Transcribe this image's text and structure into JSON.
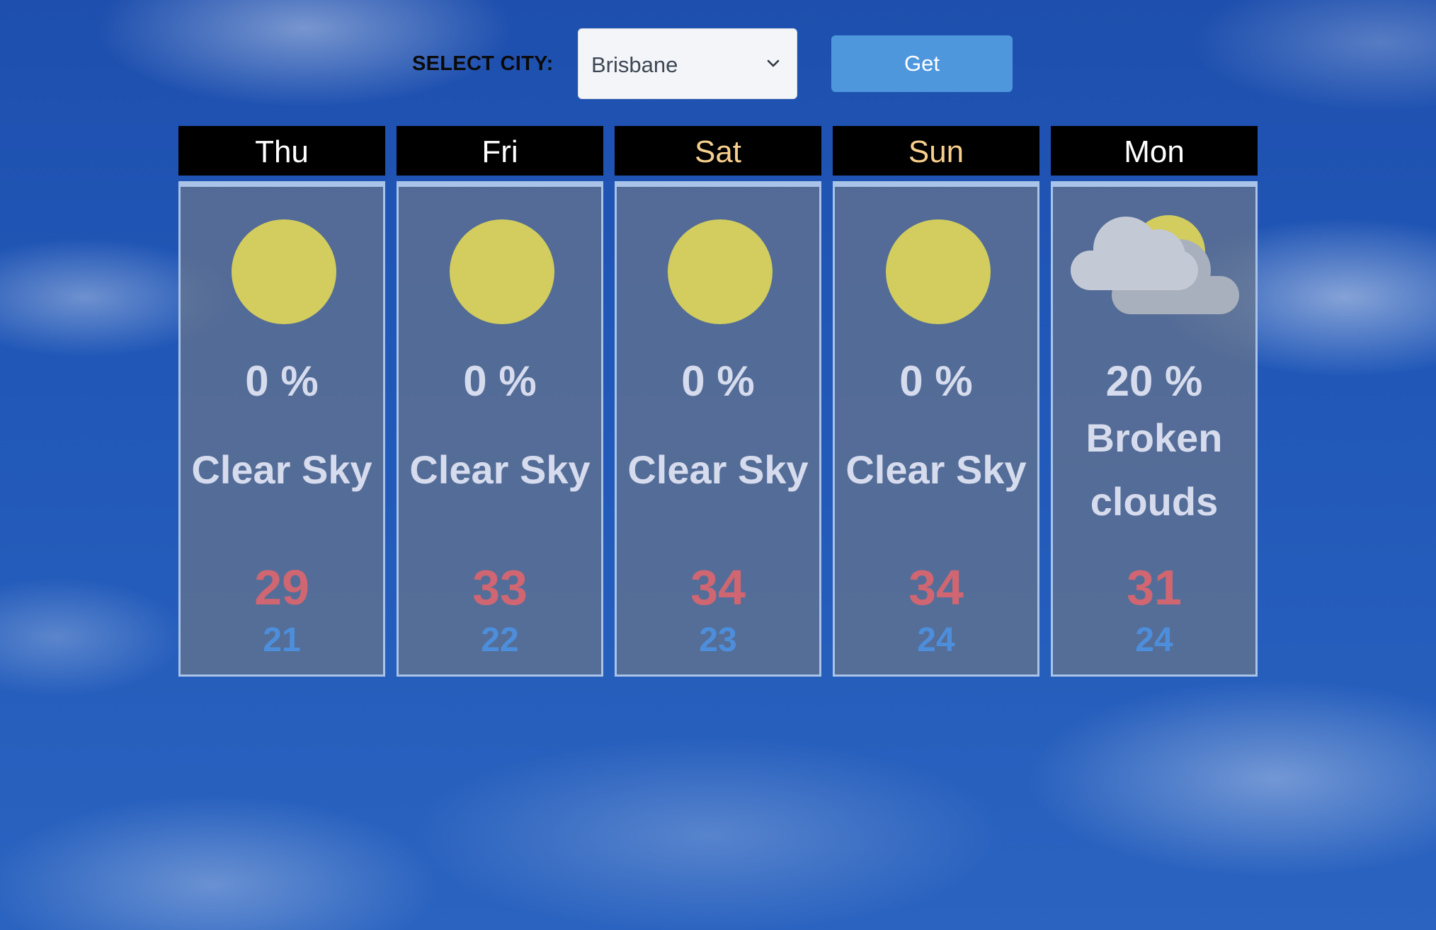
{
  "controls": {
    "city_label": "SELECT CITY:",
    "city_selected": "Brisbane",
    "get_button": "Get"
  },
  "colors": {
    "header_bg": "#000000",
    "weekday_header_text": "#ffffff",
    "weekend_header_text": "#f7cf8d",
    "high_temp": "#cf6672",
    "low_temp": "#4d8edc",
    "button_bg": "#4f97dd",
    "sun": "#d9d35b",
    "cloud": "#b9c1cf"
  },
  "days": [
    {
      "name": "Thu",
      "weekend": false,
      "icon": "sun-icon",
      "precip": "0 %",
      "description": "Clear Sky",
      "high": "29",
      "low": "21"
    },
    {
      "name": "Fri",
      "weekend": false,
      "icon": "sun-icon",
      "precip": "0 %",
      "description": "Clear Sky",
      "high": "33",
      "low": "22"
    },
    {
      "name": "Sat",
      "weekend": true,
      "icon": "sun-icon",
      "precip": "0 %",
      "description": "Clear Sky",
      "high": "34",
      "low": "23"
    },
    {
      "name": "Sun",
      "weekend": true,
      "icon": "sun-icon",
      "precip": "0 %",
      "description": "Clear Sky",
      "high": "34",
      "low": "24"
    },
    {
      "name": "Mon",
      "weekend": false,
      "icon": "broken-clouds-icon",
      "precip": "20 %",
      "description": "Broken clouds",
      "high": "31",
      "low": "24"
    }
  ]
}
